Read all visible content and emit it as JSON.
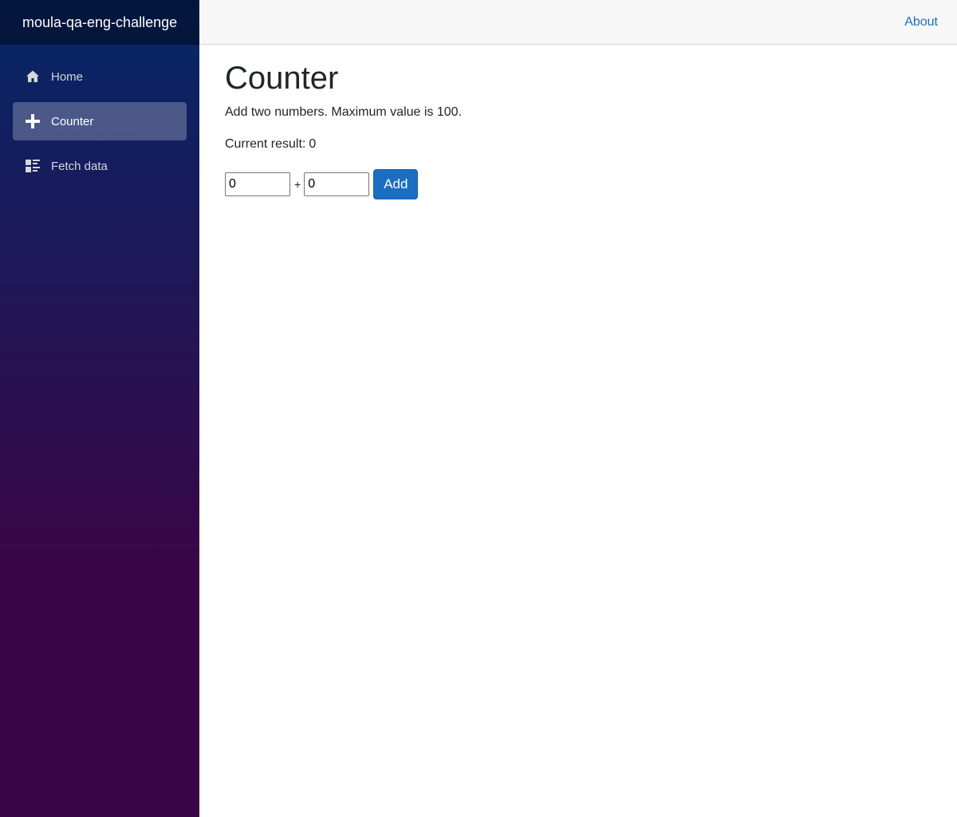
{
  "brand": "moula-qa-eng-challenge",
  "nav": {
    "items": [
      {
        "label": "Home",
        "icon": "home-icon",
        "active": false
      },
      {
        "label": "Counter",
        "icon": "plus-icon",
        "active": true
      },
      {
        "label": "Fetch data",
        "icon": "list-rich-icon",
        "active": false
      }
    ]
  },
  "topbar": {
    "about_label": "About"
  },
  "page": {
    "title": "Counter",
    "description": "Add two numbers. Maximum value is 100.",
    "result_label": "Current result:",
    "result_value": "0",
    "input_a": "0",
    "operator": "+",
    "input_b": "0",
    "add_label": "Add"
  },
  "colors": {
    "accent": "#1b6ec2",
    "sidebar_top": "#052767",
    "sidebar_bottom": "#3a0647"
  }
}
